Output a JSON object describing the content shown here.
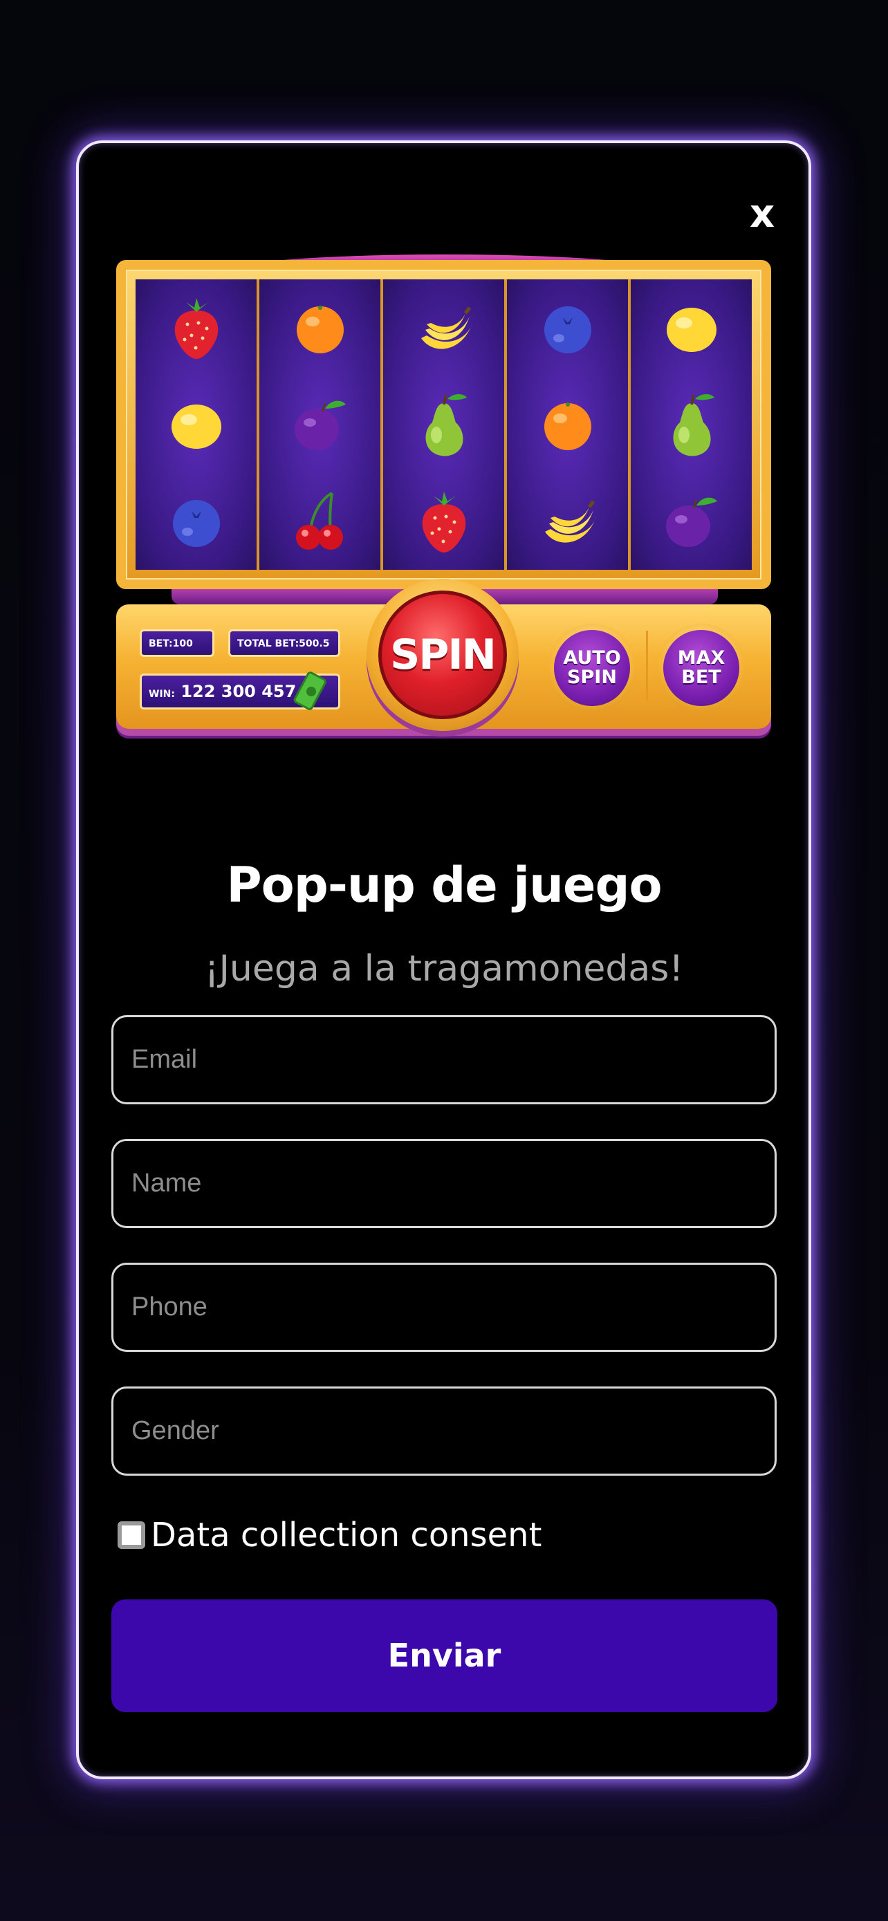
{
  "popup": {
    "close_label": "x",
    "title": "Pop-up de juego",
    "subtitle": "¡Juega a la tragamonedas!"
  },
  "slot_machine": {
    "reels": [
      [
        "strawberry",
        "lemon",
        "blueberry"
      ],
      [
        "orange",
        "plum",
        "cherries"
      ],
      [
        "banana",
        "pear",
        "strawberry"
      ],
      [
        "blueberry",
        "orange",
        "banana"
      ],
      [
        "lemon",
        "pear",
        "plum"
      ]
    ],
    "bet_label": "BET:",
    "bet_value": "100",
    "total_bet_label": "TOTAL BET:",
    "total_bet_value": "500.5",
    "win_label": "WIN:",
    "win_value": "122 300 457",
    "spin_label": "SPIN",
    "auto_spin_label": "AUTO\nSPIN",
    "max_bet_label": "MAX\nBET"
  },
  "form": {
    "email_placeholder": "Email",
    "name_placeholder": "Name",
    "phone_placeholder": "Phone",
    "gender_placeholder": "Gender",
    "consent_label": "Data collection consent",
    "consent_checked": false,
    "submit_label": "Enviar"
  },
  "colors": {
    "accent": "#3c07ab",
    "glow": "#9b6bff",
    "reel_bg": "#3a1a86",
    "frame_gold": "#f4b53a",
    "spin_red": "#e0202a"
  }
}
